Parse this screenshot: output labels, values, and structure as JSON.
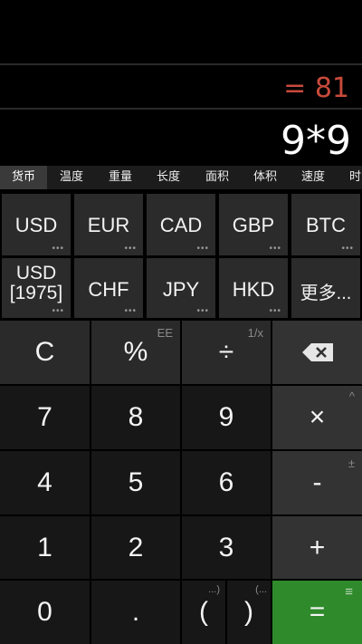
{
  "display": {
    "result": "= 81",
    "expression": "9*9"
  },
  "tabs": [
    "货币",
    "温度",
    "重量",
    "长度",
    "面积",
    "体积",
    "速度",
    "时"
  ],
  "currencies": {
    "row1": [
      "USD",
      "EUR",
      "CAD",
      "GBP",
      "BTC"
    ],
    "row2": [
      "USD\n[1975]",
      "CHF",
      "JPY",
      "HKD",
      "更多..."
    ],
    "more_dots": "•••"
  },
  "keys": {
    "clear": "C",
    "percent": "%",
    "percent_sec": "EE",
    "divide": "÷",
    "divide_sec": "1/x",
    "backspace": "⌫",
    "seven": "7",
    "eight": "8",
    "nine": "9",
    "multiply": "×",
    "multiply_sec": "^",
    "four": "4",
    "five": "5",
    "six": "6",
    "minus": "-",
    "minus_sec": "±",
    "one": "1",
    "two": "2",
    "three": "3",
    "plus": "+",
    "zero": "0",
    "dot": ".",
    "lparen": "(",
    "lparen_sec": "...)",
    "rparen": ")",
    "rparen_sec": "(...",
    "equals": "=",
    "equals_sec": "≡"
  }
}
